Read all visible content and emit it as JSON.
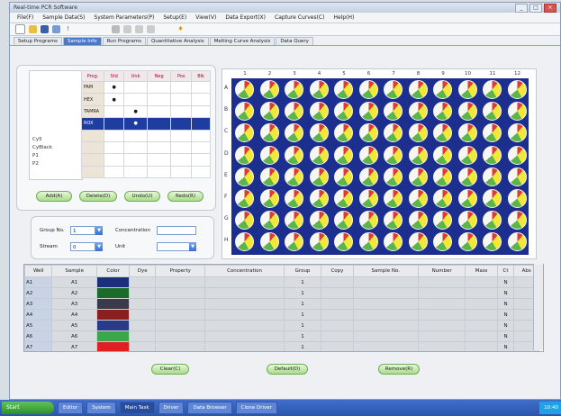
{
  "window": {
    "title": "Real-time PCR Software"
  },
  "menu": [
    "File(F)",
    "Sample Data(S)",
    "System Parameters(P)",
    "Setup(E)",
    "View(V)",
    "Data Export(X)",
    "Capture Curves(C)",
    "Help(H)"
  ],
  "tabs": [
    "Setup Programs",
    "Sample Info",
    "Run Programs",
    "Quantitative Analysis",
    "Melting Curve Analysis",
    "Data Query"
  ],
  "active_tab": 1,
  "side_list": [
    "",
    "",
    "",
    "",
    "",
    "",
    "",
    "",
    "Cy5",
    "CyBlack",
    "P1",
    "P2"
  ],
  "grid": {
    "headers": [
      "Prog.",
      "Std",
      "Unk",
      "Neg",
      "Pos",
      "Blk"
    ],
    "rows": [
      {
        "label": "FAM",
        "marks": [
          "●",
          "",
          "",
          "",
          ""
        ],
        "selected": false
      },
      {
        "label": "HEX",
        "marks": [
          "●",
          "",
          "",
          "",
          ""
        ],
        "selected": false
      },
      {
        "label": "TAMRA",
        "marks": [
          "",
          "●",
          "",
          "",
          ""
        ],
        "selected": false
      },
      {
        "label": "ROX",
        "marks": [
          "",
          "●",
          "",
          "",
          ""
        ],
        "selected": true
      },
      {
        "label": "",
        "marks": [
          "",
          "",
          "",
          "",
          ""
        ],
        "selected": false
      },
      {
        "label": "",
        "marks": [
          "",
          "",
          "",
          "",
          ""
        ],
        "selected": false
      },
      {
        "label": "",
        "marks": [
          "",
          "",
          "",
          "",
          ""
        ],
        "selected": false
      },
      {
        "label": "",
        "marks": [
          "",
          "",
          "",
          "",
          ""
        ],
        "selected": false
      }
    ]
  },
  "buttons": {
    "add": "Add(A)",
    "delete": "Delete(D)",
    "undo": "Undo(U)",
    "redo": "Redo(R)",
    "clear": "Clear(C)",
    "default": "Default(D)",
    "remove": "Remove(R)"
  },
  "group_form": {
    "group_no_label": "Group No.",
    "group_no_value": "1",
    "concentration_label": "Concentration",
    "concentration_value": "",
    "stream_label": "Stream",
    "stream_value": "0",
    "unit_label": "Unit",
    "unit_value": ""
  },
  "plate": {
    "cols": [
      "1",
      "2",
      "3",
      "4",
      "5",
      "6",
      "7",
      "8",
      "9",
      "10",
      "11",
      "12"
    ],
    "rows": [
      "A",
      "B",
      "C",
      "D",
      "E",
      "F",
      "G",
      "H"
    ]
  },
  "sample_table": {
    "headers": [
      "Well",
      "Sample",
      "Color",
      "Dye",
      "Property",
      "Concentration",
      "Group",
      "Copy",
      "Sample No.",
      "Number",
      "Mass",
      "Ct",
      "Abs"
    ],
    "rows": [
      {
        "well": "A1",
        "sample": "A1",
        "color": "#1b2f7a"
      },
      {
        "well": "A2",
        "sample": "A2",
        "color": "#1b6b2a"
      },
      {
        "well": "A3",
        "sample": "A3",
        "color": "#3a3a4a"
      },
      {
        "well": "A4",
        "sample": "A4",
        "color": "#8a1f1f"
      },
      {
        "well": "A5",
        "sample": "A5",
        "color": "#2a3a8a"
      },
      {
        "well": "A6",
        "sample": "A6",
        "color": "#3aa84a"
      },
      {
        "well": "A7",
        "sample": "A7",
        "color": "#e02020"
      },
      {
        "well": "A8",
        "sample": "A8",
        "color": "#2a9a3a"
      }
    ],
    "group_value": "1",
    "ct_value": "N"
  },
  "taskbar": {
    "start": "Start",
    "items": [
      "Editor",
      "System",
      "Main Task",
      "Driver",
      "Data Browser",
      "Clone Driver"
    ],
    "active": 2,
    "clock": "10:40"
  }
}
